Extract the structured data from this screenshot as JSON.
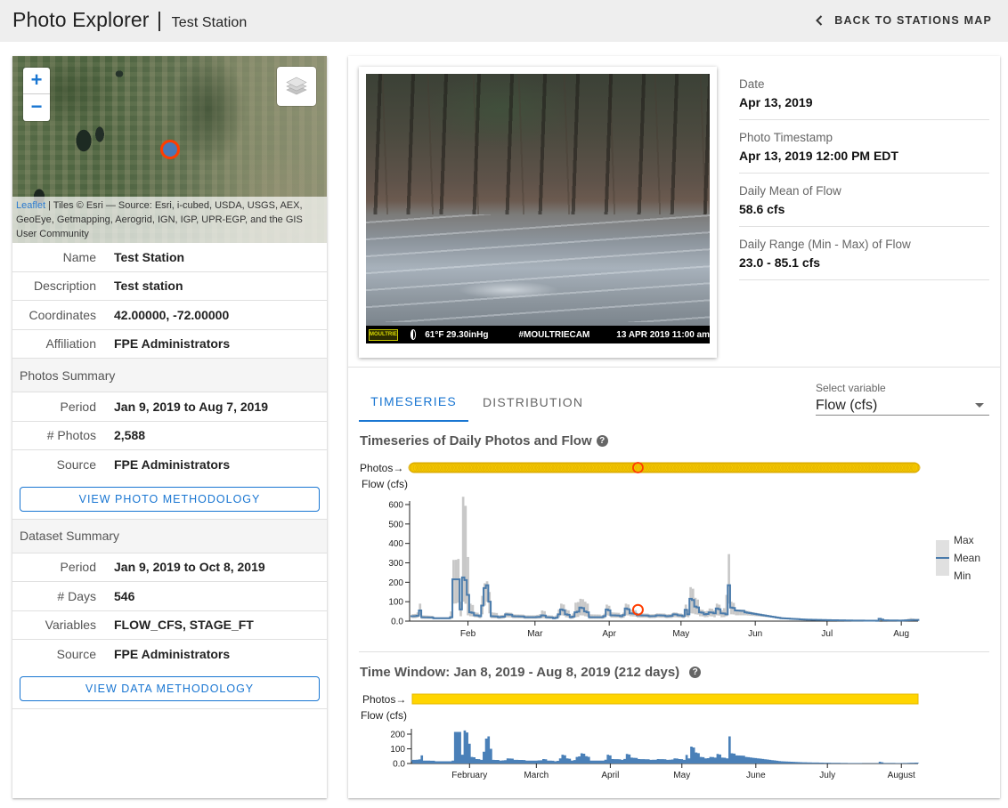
{
  "header": {
    "app_title": "Photo Explorer",
    "separator": "|",
    "station_name": "Test Station",
    "back_label": "BACK TO STATIONS MAP"
  },
  "map": {
    "zoom_in": "+",
    "zoom_out": "−",
    "attribution_link": "Leaflet",
    "attribution_text": " | Tiles © Esri — Source: Esri, i-cubed, USDA, USGS, AEX, GeoEye, Getmapping, Aerogrid, IGN, IGP, UPR-EGP, and the GIS User Community",
    "icons": {
      "layers": "layers-icon",
      "marker": "station-marker"
    }
  },
  "station": {
    "rows": [
      {
        "label": "Name",
        "value": "Test Station"
      },
      {
        "label": "Description",
        "value": "Test station"
      },
      {
        "label": "Coordinates",
        "value": "42.00000, -72.00000"
      },
      {
        "label": "Affiliation",
        "value": "FPE Administrators"
      }
    ]
  },
  "photos_summary": {
    "title": "Photos Summary",
    "rows": [
      {
        "label": "Period",
        "value": "Jan 9, 2019 to Aug 7, 2019"
      },
      {
        "label": "# Photos",
        "value": "2,588"
      },
      {
        "label": "Source",
        "value": "FPE Administrators"
      }
    ],
    "button": "VIEW PHOTO METHODOLOGY"
  },
  "dataset_summary": {
    "title": "Dataset Summary",
    "rows": [
      {
        "label": "Period",
        "value": "Jan 9, 2019 to Oct 8, 2019"
      },
      {
        "label": "# Days",
        "value": "546"
      },
      {
        "label": "Variables",
        "value": "FLOW_CFS, STAGE_FT"
      },
      {
        "label": "Source",
        "value": "FPE Administrators"
      }
    ],
    "button": "VIEW DATA METHODOLOGY"
  },
  "photo": {
    "stamp_brand": "MOULTRIE",
    "stamp_temp": "61°F  29.30inHg",
    "stamp_tag": "#MOULTRIECAM",
    "stamp_datetime": "13 APR 2019  11:00 am"
  },
  "photo_meta": [
    {
      "label": "Date",
      "value": "Apr 13, 2019"
    },
    {
      "label": "Photo Timestamp",
      "value": "Apr 13, 2019 12:00 PM EDT"
    },
    {
      "label": "Daily Mean of Flow",
      "value": "58.6 cfs"
    },
    {
      "label": "Daily Range (Min - Max) of Flow",
      "value": "23.0 - 85.1 cfs"
    }
  ],
  "tabs": [
    {
      "label": "TIMESERIES",
      "active": true
    },
    {
      "label": "DISTRIBUTION",
      "active": false
    }
  ],
  "variable_select": {
    "label": "Select variable",
    "value": "Flow (cfs)"
  },
  "colors": {
    "accent": "#1976d2",
    "mean_line": "#4a7bab",
    "range_fill": "#c8c8c8",
    "photos_bar": "#f5c800",
    "selected_marker": "#ff3d00"
  },
  "chart_data": [
    {
      "type": "line",
      "title": "Timeseries of Daily Photos and Flow",
      "photos_label": "Photos→",
      "ylabel": "Flow (cfs)",
      "ylim": [
        0,
        650
      ],
      "yticks": [
        0,
        100,
        200,
        300,
        400,
        500,
        600
      ],
      "ytick_labels": [
        "0.0",
        "100",
        "200",
        "300",
        "400",
        "500",
        "600"
      ],
      "xlim": [
        "2019-01-08",
        "2019-08-08"
      ],
      "xticks": [
        {
          "date": "2019-02-01",
          "label": "Feb"
        },
        {
          "date": "2019-03-01",
          "label": "Mar"
        },
        {
          "date": "2019-04-01",
          "label": "Apr"
        },
        {
          "date": "2019-05-01",
          "label": "May"
        },
        {
          "date": "2019-06-01",
          "label": "Jun"
        },
        {
          "date": "2019-07-01",
          "label": "Jul"
        },
        {
          "date": "2019-08-01",
          "label": "Aug"
        }
      ],
      "legend": [
        "Max",
        "Mean",
        "Min"
      ],
      "legend_position": "right",
      "photos_period": [
        "2019-01-09",
        "2019-08-07"
      ],
      "selected": {
        "date": "2019-04-13",
        "mean": 58.6,
        "min": 23.0,
        "max": 85.1
      },
      "series": {
        "keypoints_day_mean_min_max": [
          [
            0,
            25,
            15,
            35
          ],
          [
            3,
            28,
            18,
            45
          ],
          [
            4,
            55,
            30,
            90
          ],
          [
            5,
            20,
            12,
            30
          ],
          [
            10,
            15,
            10,
            20
          ],
          [
            16,
            15,
            10,
            20
          ],
          [
            17,
            20,
            12,
            50
          ],
          [
            18,
            215,
            90,
            315
          ],
          [
            20,
            215,
            95,
            320
          ],
          [
            21,
            60,
            25,
            100
          ],
          [
            22,
            225,
            100,
            640
          ],
          [
            24,
            135,
            30,
            330
          ],
          [
            25,
            45,
            25,
            90
          ],
          [
            27,
            30,
            20,
            45
          ],
          [
            29,
            25,
            15,
            35
          ],
          [
            30,
            80,
            35,
            130
          ],
          [
            31,
            170,
            80,
            195
          ],
          [
            32,
            185,
            100,
            205
          ],
          [
            33,
            100,
            40,
            150
          ],
          [
            34,
            25,
            15,
            45
          ],
          [
            37,
            20,
            12,
            30
          ],
          [
            40,
            35,
            20,
            45
          ],
          [
            43,
            25,
            15,
            35
          ],
          [
            48,
            20,
            12,
            30
          ],
          [
            52,
            20,
            12,
            30
          ],
          [
            55,
            30,
            15,
            55
          ],
          [
            57,
            20,
            12,
            30
          ],
          [
            60,
            15,
            10,
            25
          ],
          [
            62,
            35,
            20,
            60
          ],
          [
            63,
            60,
            30,
            90
          ],
          [
            65,
            35,
            20,
            60
          ],
          [
            67,
            20,
            12,
            30
          ],
          [
            69,
            45,
            20,
            95
          ],
          [
            71,
            70,
            30,
            115
          ],
          [
            73,
            50,
            25,
            100
          ],
          [
            75,
            20,
            12,
            35
          ],
          [
            80,
            20,
            12,
            30
          ],
          [
            82,
            60,
            30,
            85
          ],
          [
            84,
            30,
            18,
            45
          ],
          [
            88,
            25,
            15,
            35
          ],
          [
            90,
            65,
            30,
            90
          ],
          [
            92,
            40,
            25,
            60
          ],
          [
            95,
            30,
            18,
            40
          ],
          [
            100,
            25,
            15,
            35
          ],
          [
            103,
            30,
            18,
            40
          ],
          [
            107,
            25,
            15,
            35
          ],
          [
            110,
            35,
            20,
            45
          ],
          [
            112,
            30,
            18,
            40
          ],
          [
            114,
            25,
            15,
            35
          ],
          [
            115,
            58.6,
            23,
            85.1
          ],
          [
            116,
            35,
            20,
            60
          ],
          [
            117,
            115,
            40,
            175
          ],
          [
            119,
            75,
            35,
            120
          ],
          [
            121,
            45,
            25,
            60
          ],
          [
            123,
            35,
            20,
            50
          ],
          [
            125,
            45,
            25,
            65
          ],
          [
            127,
            40,
            20,
            55
          ],
          [
            128,
            65,
            30,
            90
          ],
          [
            130,
            40,
            20,
            55
          ],
          [
            132,
            35,
            25,
            135
          ],
          [
            133,
            185,
            90,
            345
          ],
          [
            134,
            70,
            35,
            100
          ],
          [
            136,
            55,
            30,
            60
          ],
          [
            140,
            45,
            30,
            55
          ],
          [
            145,
            35,
            25,
            40
          ],
          [
            150,
            25,
            20,
            30
          ],
          [
            155,
            15,
            12,
            20
          ],
          [
            165,
            8,
            6,
            10
          ],
          [
            175,
            5,
            4,
            7
          ],
          [
            185,
            3,
            2,
            4
          ],
          [
            195,
            2,
            1,
            3
          ],
          [
            196,
            12,
            5,
            15
          ],
          [
            198,
            4,
            3,
            6
          ],
          [
            205,
            3,
            2,
            4
          ],
          [
            209,
            5,
            3,
            15
          ],
          [
            211,
            6,
            4,
            12
          ]
        ]
      }
    },
    {
      "type": "area",
      "title": "Time Window: Jan 8, 2019 - Aug 8, 2019 (212 days)",
      "photos_label": "Photos→",
      "ylabel": "Flow (cfs)",
      "ylim": [
        0,
        250
      ],
      "yticks": [
        0,
        100,
        200
      ],
      "ytick_labels": [
        "0.0",
        "100",
        "200"
      ],
      "xlim": [
        "2019-01-08",
        "2019-08-08"
      ],
      "xticks": [
        {
          "date": "2019-02-01",
          "label": "February"
        },
        {
          "date": "2019-03-01",
          "label": "March"
        },
        {
          "date": "2019-04-01",
          "label": "April"
        },
        {
          "date": "2019-05-01",
          "label": "May"
        },
        {
          "date": "2019-06-01",
          "label": "June"
        },
        {
          "date": "2019-07-01",
          "label": "July"
        },
        {
          "date": "2019-08-01",
          "label": "August"
        }
      ],
      "series_source": "mean of chart 1"
    }
  ]
}
